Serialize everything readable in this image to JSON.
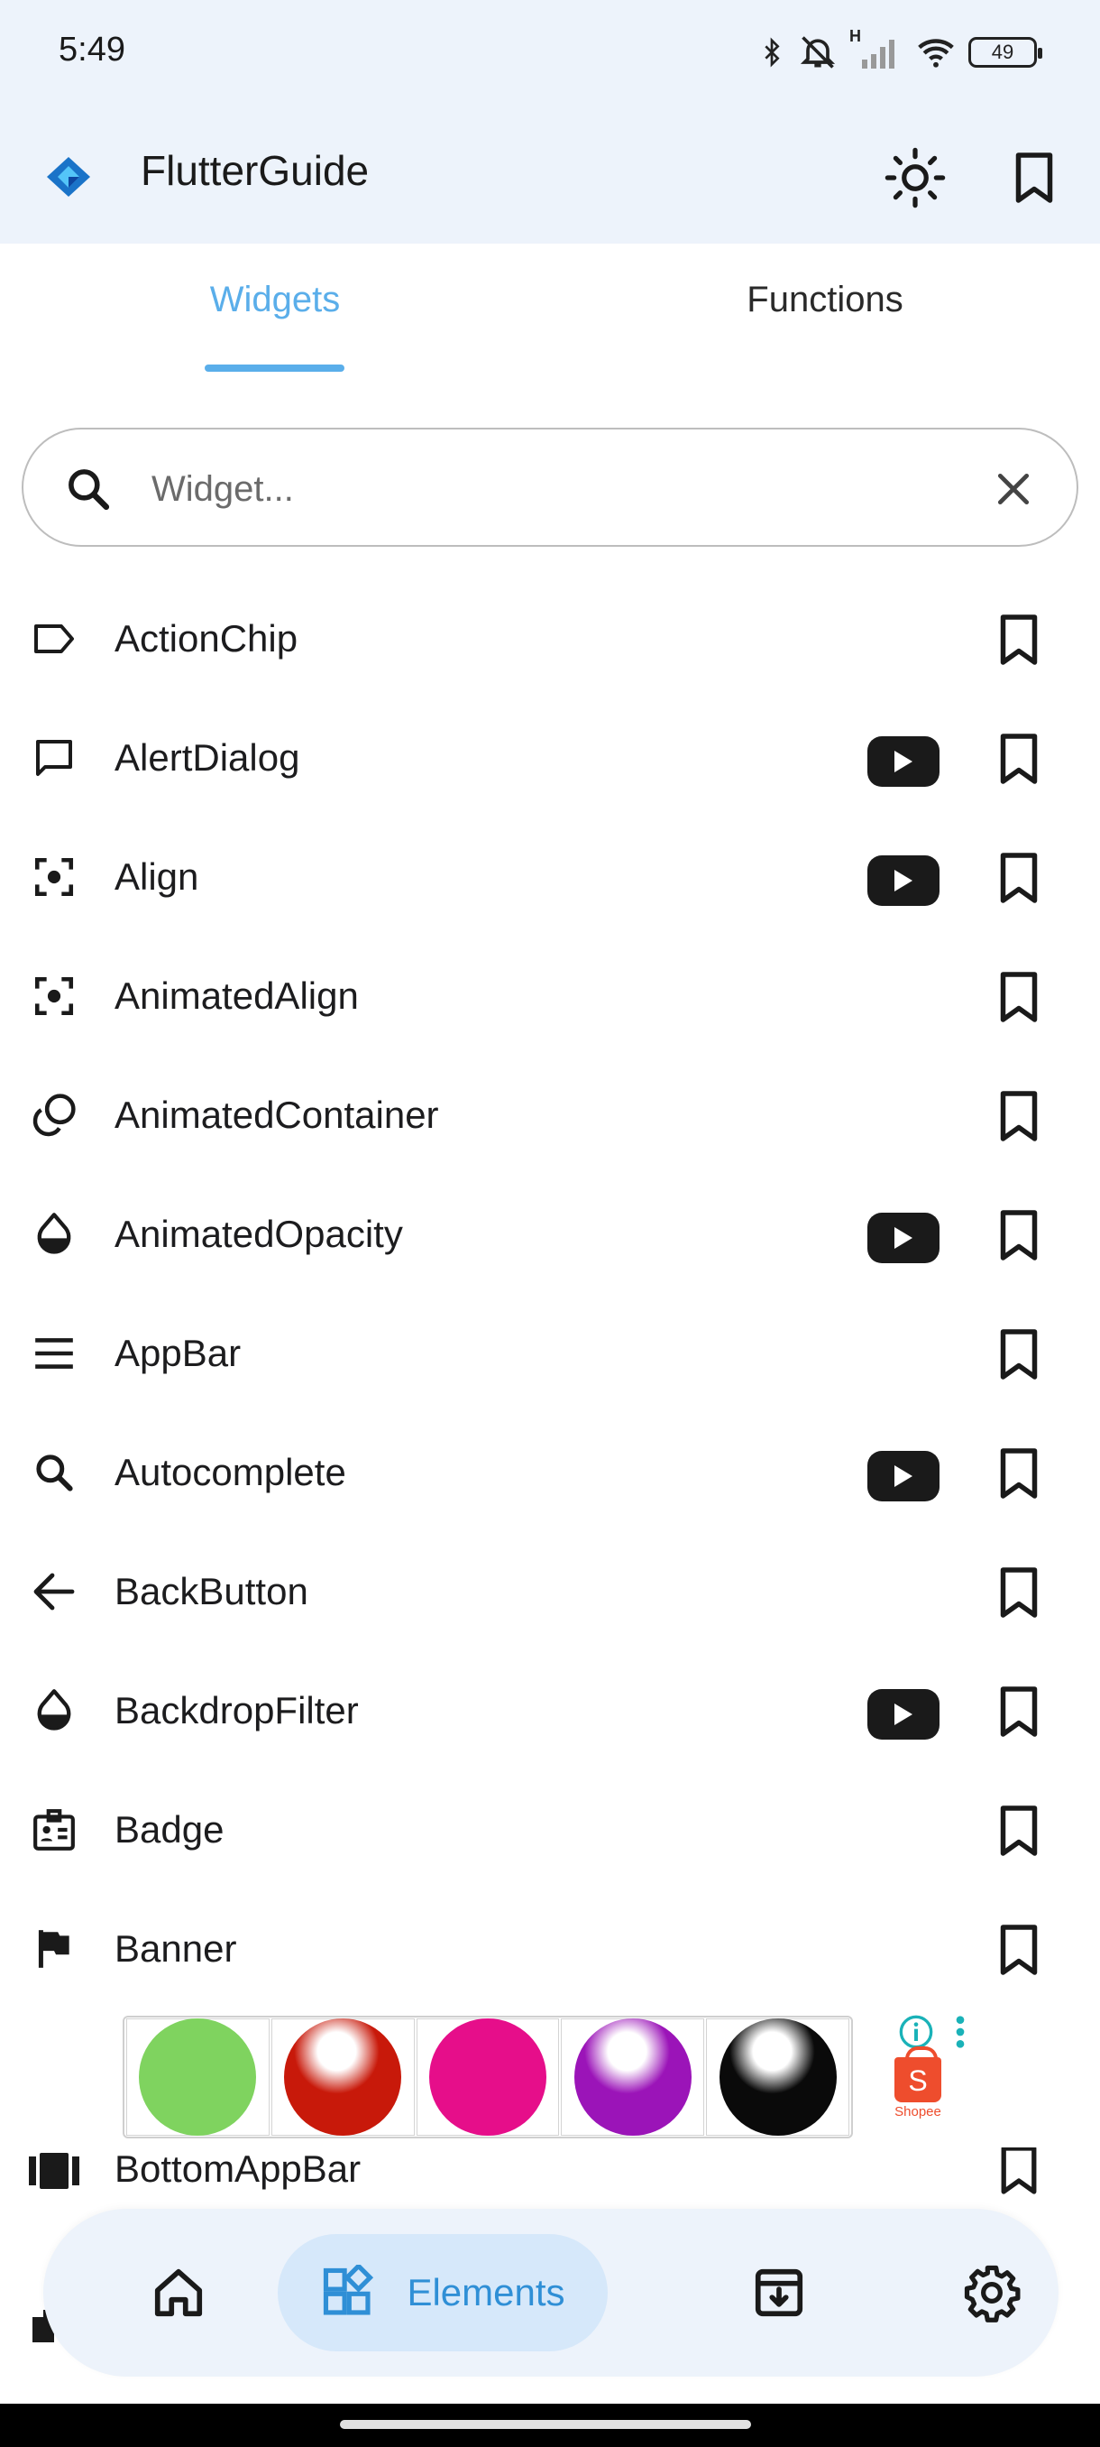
{
  "status_bar": {
    "time": "5:49",
    "network_label": "H",
    "battery": "49"
  },
  "app_bar": {
    "title": "FlutterGuide",
    "logo": "flutter-logo-icon",
    "actions": [
      "brightness-icon",
      "bookmark-icon"
    ]
  },
  "tabs": [
    {
      "label": "Widgets",
      "active": true
    },
    {
      "label": "Functions",
      "active": false
    }
  ],
  "search": {
    "placeholder": "Widget...",
    "value": ""
  },
  "widgets": [
    {
      "label": "ActionChip",
      "icon": "label-outline-icon",
      "video": false
    },
    {
      "label": "AlertDialog",
      "icon": "chat-bubble-outline-icon",
      "video": true
    },
    {
      "label": "Align",
      "icon": "center-focus-icon",
      "video": true
    },
    {
      "label": "AnimatedAlign",
      "icon": "center-focus-icon",
      "video": false
    },
    {
      "label": "AnimatedContainer",
      "icon": "animation-icon",
      "video": false
    },
    {
      "label": "AnimatedOpacity",
      "icon": "opacity-icon",
      "video": true
    },
    {
      "label": "AppBar",
      "icon": "menu-icon",
      "video": false
    },
    {
      "label": "Autocomplete",
      "icon": "search-icon",
      "video": true
    },
    {
      "label": "BackButton",
      "icon": "arrow-back-icon",
      "video": false
    },
    {
      "label": "BackdropFilter",
      "icon": "opacity-icon",
      "video": true
    },
    {
      "label": "Badge",
      "icon": "badge-icon",
      "video": false
    },
    {
      "label": "Banner",
      "icon": "flag-icon",
      "video": false
    }
  ],
  "partial_widgets": [
    {
      "label": "BottomAppBar",
      "icon": "view-array-icon"
    }
  ],
  "ad": {
    "swatch_colors": [
      "#7fd35f",
      "#c8190a",
      "#e60e8a",
      "#9b14b8",
      "#0a0a0a"
    ],
    "brand": "Shopee",
    "brand_color": "#ee4d2d",
    "info_color": "#1ab2b8"
  },
  "bottom_nav": {
    "items": [
      {
        "icon": "home-icon",
        "label": ""
      },
      {
        "icon": "widgets-icon",
        "label": "Elements",
        "active": true
      },
      {
        "icon": "archive-icon",
        "label": ""
      },
      {
        "icon": "settings-icon",
        "label": ""
      }
    ]
  },
  "colors": {
    "accent": "#5aaeea",
    "nav_active_bg": "#d6e8fa",
    "appbar_bg": "#edf3fb"
  }
}
